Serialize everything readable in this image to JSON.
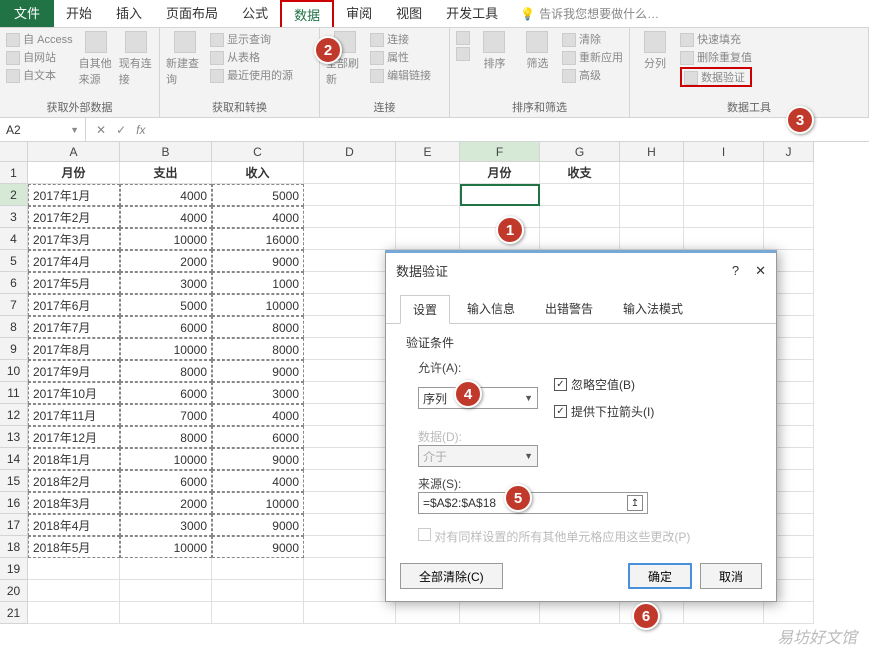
{
  "ribbon": {
    "tabs": [
      "文件",
      "开始",
      "插入",
      "页面布局",
      "公式",
      "数据",
      "审阅",
      "视图",
      "开发工具"
    ],
    "active_tab": "数据",
    "tell_me_placeholder": "告诉我您想要做什么…",
    "groups": {
      "external_data": {
        "label": "获取外部数据",
        "items": [
          "自 Access",
          "自网站",
          "自文本"
        ],
        "other": "自其他来源",
        "conn": "现有连接"
      },
      "get_transform": {
        "label": "获取和转换",
        "new_query": "新建查询",
        "show": "显示查询",
        "from_table": "从表格",
        "recent": "最近使用的源"
      },
      "connections": {
        "label": "连接",
        "refresh": "全部刷新",
        "conn": "连接",
        "props": "属性",
        "edit": "编辑链接"
      },
      "sort_filter": {
        "label": "排序和筛选",
        "sort": "排序",
        "filter": "筛选",
        "clear": "清除",
        "reapply": "重新应用",
        "advanced": "高级"
      },
      "data_tools": {
        "label": "数据工具",
        "split": "分列",
        "flash": "快速填充",
        "dup": "删除重复值",
        "dv": "数据验证"
      }
    }
  },
  "name_box": "A2",
  "grid": {
    "columns": [
      "A",
      "B",
      "C",
      "D",
      "E",
      "F",
      "G",
      "H",
      "I",
      "J"
    ],
    "headers": {
      "A": "月份",
      "B": "支出",
      "C": "收入",
      "F": "月份",
      "G": "收支"
    },
    "rows": [
      [
        "2017年1月",
        "4000",
        "5000"
      ],
      [
        "2017年2月",
        "4000",
        "4000"
      ],
      [
        "2017年3月",
        "10000",
        "16000"
      ],
      [
        "2017年4月",
        "2000",
        "9000"
      ],
      [
        "2017年5月",
        "3000",
        "1000"
      ],
      [
        "2017年6月",
        "5000",
        "10000"
      ],
      [
        "2017年7月",
        "6000",
        "8000"
      ],
      [
        "2017年8月",
        "10000",
        "8000"
      ],
      [
        "2017年9月",
        "8000",
        "9000"
      ],
      [
        "2017年10月",
        "6000",
        "3000"
      ],
      [
        "2017年11月",
        "7000",
        "4000"
      ],
      [
        "2017年12月",
        "8000",
        "6000"
      ],
      [
        "2018年1月",
        "10000",
        "9000"
      ],
      [
        "2018年2月",
        "6000",
        "4000"
      ],
      [
        "2018年3月",
        "2000",
        "10000"
      ],
      [
        "2018年4月",
        "3000",
        "9000"
      ],
      [
        "2018年5月",
        "10000",
        "9000"
      ]
    ],
    "active_cell": "F2",
    "selected_col": "F",
    "selected_row": "2"
  },
  "dialog": {
    "title": "数据验证",
    "tabs": [
      "设置",
      "输入信息",
      "出错警告",
      "输入法模式"
    ],
    "active_tab": "设置",
    "condition_label": "验证条件",
    "allow_label": "允许(A):",
    "allow_value": "序列",
    "data_label": "数据(D):",
    "data_value": "介于",
    "ignore_blank": "忽略空值(B)",
    "dropdown_arrow": "提供下拉箭头(I)",
    "source_label": "来源(S):",
    "source_value": "=$A$2:$A$18",
    "apply_all": "对有同样设置的所有其他单元格应用这些更改(P)",
    "clear_all": "全部清除(C)",
    "ok": "确定",
    "cancel": "取消"
  },
  "badges": [
    "1",
    "2",
    "3",
    "4",
    "5",
    "6"
  ],
  "watermark": "易坊好文馆"
}
